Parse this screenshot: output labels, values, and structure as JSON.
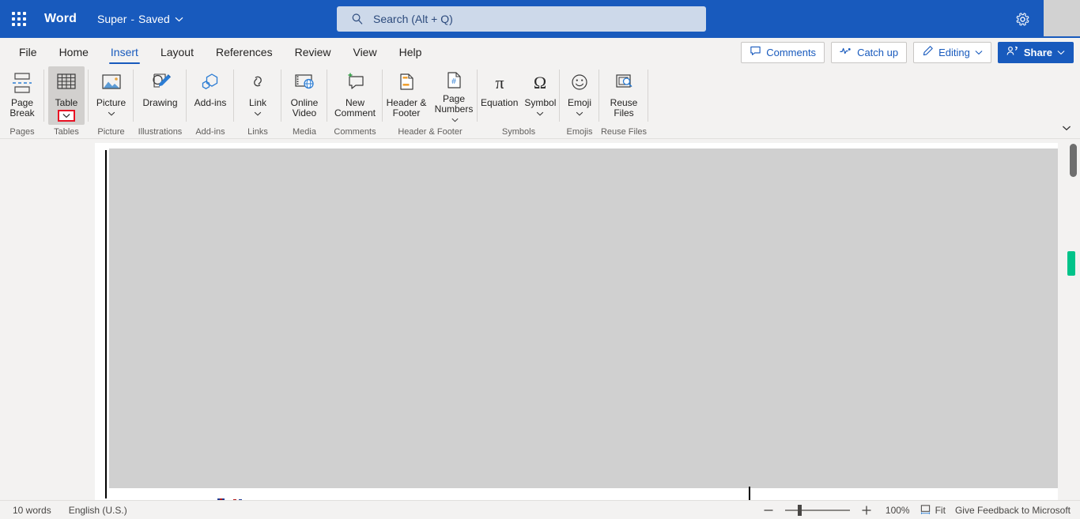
{
  "titlebar": {
    "waffle_label": "app-launcher",
    "app_name": "Word",
    "doc_name": "Super",
    "separator": "-",
    "save_state": "Saved",
    "settings_label": "settings"
  },
  "search": {
    "placeholder": "Search (Alt + Q)",
    "value": "Search (Alt + Q)"
  },
  "tabs": [
    {
      "label": "File",
      "active": false
    },
    {
      "label": "Home",
      "active": false
    },
    {
      "label": "Insert",
      "active": true
    },
    {
      "label": "Layout",
      "active": false
    },
    {
      "label": "References",
      "active": false
    },
    {
      "label": "Review",
      "active": false
    },
    {
      "label": "View",
      "active": false
    },
    {
      "label": "Help",
      "active": false
    }
  ],
  "tab_actions": {
    "comments": "Comments",
    "catch_up": "Catch up",
    "editing": "Editing",
    "share": "Share"
  },
  "ribbon": {
    "groups": [
      {
        "label": "Pages",
        "items": [
          {
            "label": "Page\nBreak",
            "icon": "page-break-icon",
            "dropdown": false,
            "selected": false
          }
        ]
      },
      {
        "label": "Tables",
        "items": [
          {
            "label": "Table",
            "icon": "table-icon",
            "dropdown": true,
            "dropdown_highlight": true,
            "selected": true
          }
        ]
      },
      {
        "label": "Picture",
        "items": [
          {
            "label": "Picture",
            "icon": "picture-icon",
            "dropdown": true,
            "selected": false
          }
        ]
      },
      {
        "label": "Illustrations",
        "items": [
          {
            "label": "Drawing",
            "icon": "drawing-icon",
            "dropdown": false,
            "selected": false
          }
        ]
      },
      {
        "label": "Add-ins",
        "items": [
          {
            "label": "Add-ins",
            "icon": "addins-icon",
            "dropdown": false,
            "selected": false
          }
        ]
      },
      {
        "label": "Links",
        "items": [
          {
            "label": "Link",
            "icon": "link-icon",
            "dropdown": true,
            "selected": false
          }
        ]
      },
      {
        "label": "Media",
        "items": [
          {
            "label": "Online\nVideo",
            "icon": "online-video-icon",
            "dropdown": false,
            "selected": false
          }
        ]
      },
      {
        "label": "Comments",
        "items": [
          {
            "label": "New\nComment",
            "icon": "new-comment-icon",
            "dropdown": false,
            "selected": false
          }
        ]
      },
      {
        "label": "Header & Footer",
        "items": [
          {
            "label": "Header &\nFooter",
            "icon": "header-footer-icon",
            "dropdown": false,
            "selected": false
          },
          {
            "label": "Page\nNumbers",
            "icon": "page-numbers-icon",
            "dropdown": "inline",
            "selected": false
          }
        ]
      },
      {
        "label": "Symbols",
        "items": [
          {
            "label": "Equation",
            "icon": "equation-icon",
            "dropdown": false,
            "selected": false
          },
          {
            "label": "Symbol",
            "icon": "symbol-icon",
            "dropdown": true,
            "selected": false
          }
        ]
      },
      {
        "label": "Emojis",
        "items": [
          {
            "label": "Emoji",
            "icon": "emoji-icon",
            "dropdown": true,
            "selected": false
          }
        ]
      },
      {
        "label": "Reuse Files",
        "items": [
          {
            "label": "Reuse\nFiles",
            "icon": "reuse-files-icon",
            "dropdown": false,
            "selected": false
          }
        ]
      }
    ],
    "collapse_label": "collapse-ribbon"
  },
  "statusbar": {
    "word_count": "10 words",
    "language": "English (U.S.)",
    "zoom_percent": "100%",
    "fit_label": "Fit",
    "feedback": "Give Feedback to Microsoft",
    "zoom_out_label": "zoom-out",
    "zoom_in_label": "zoom-in"
  },
  "colors": {
    "brand_blue": "#185abd",
    "search_bg": "#cdd9ea",
    "ribbon_bg": "#f3f2f1",
    "selected_btn": "#d2d0ce",
    "highlight_red": "#e81123",
    "scroll_marker_green": "#00c389",
    "content_gray": "#d0d0d0"
  }
}
